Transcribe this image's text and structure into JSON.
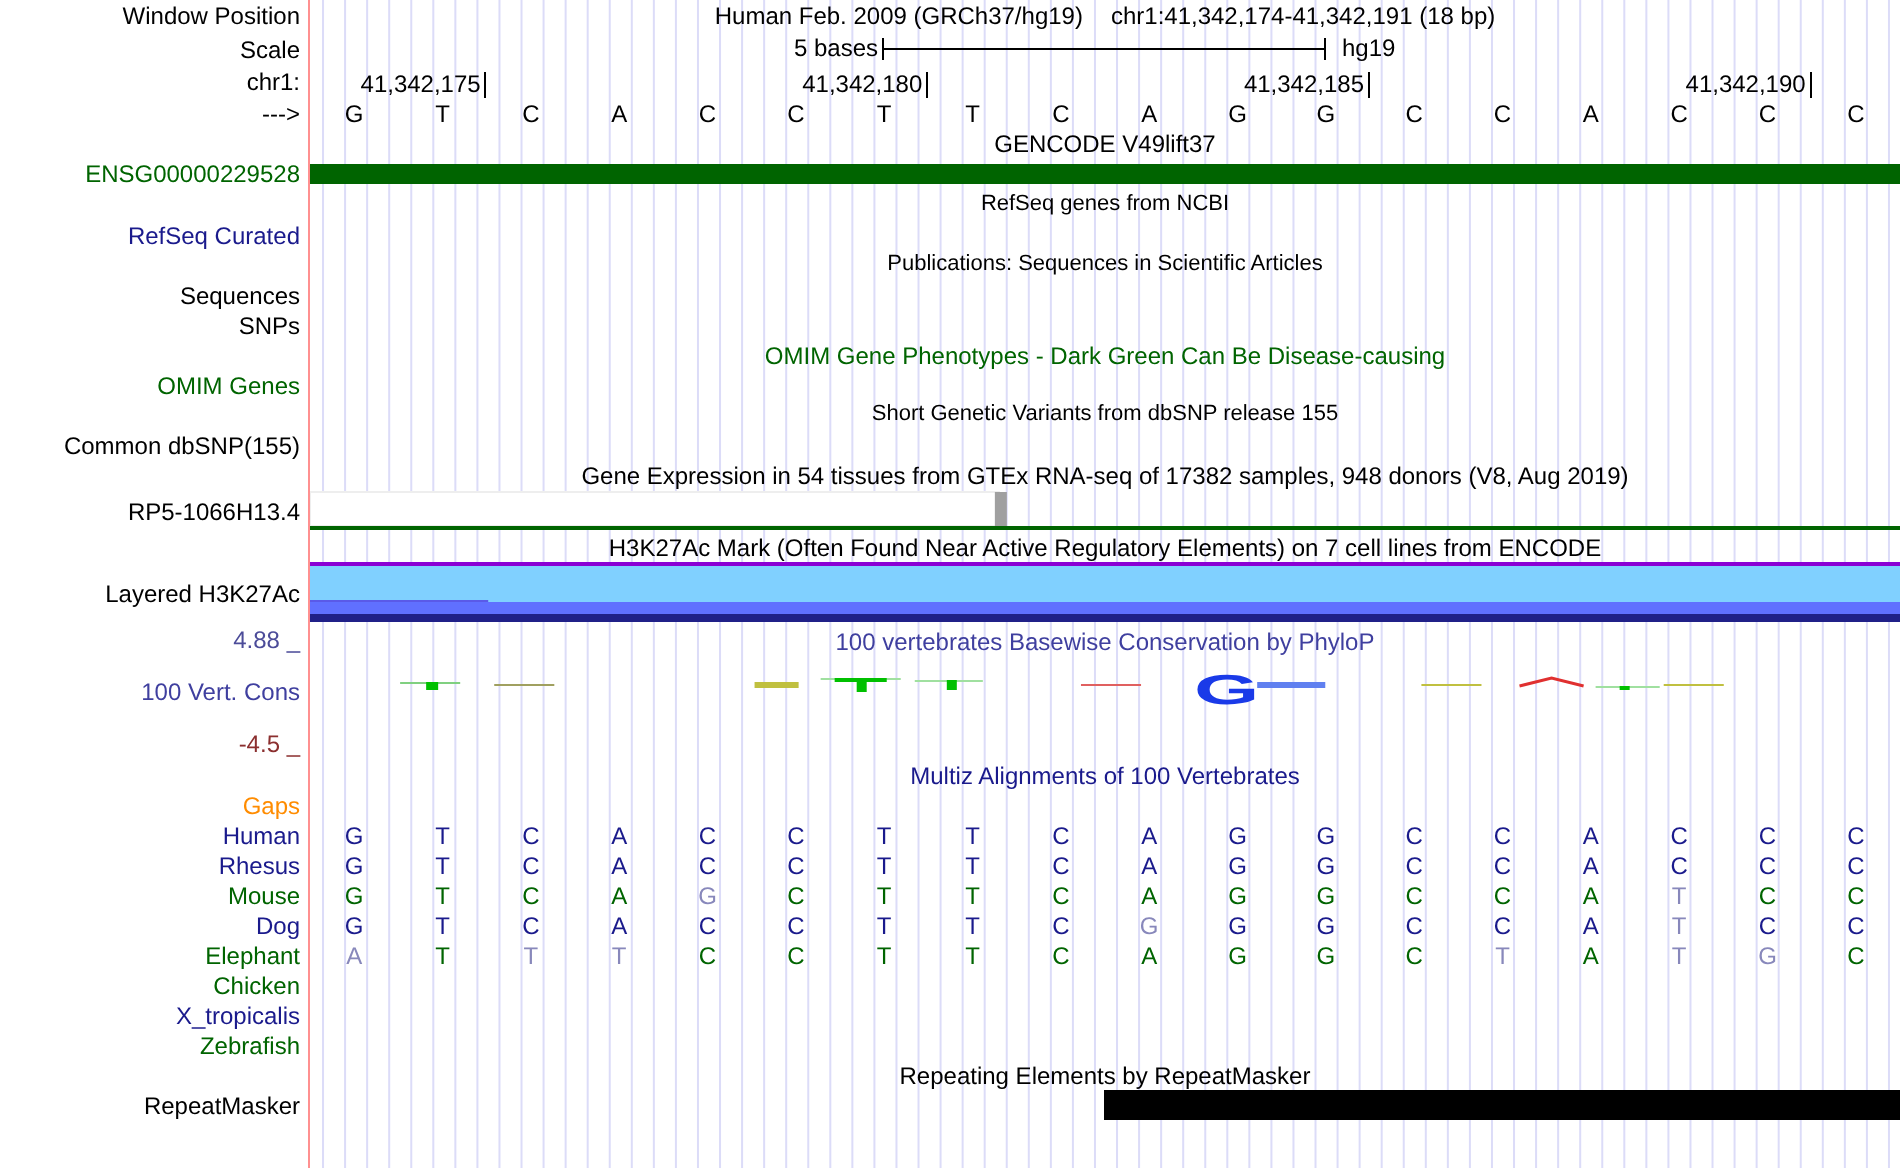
{
  "header": {
    "window_position": {
      "label": "Window Position",
      "assembly": "Human Feb. 2009 (GRCh37/hg19)",
      "position": "chr1:41,342,174-41,342,191 (18 bp)"
    },
    "scale": {
      "label": "Scale",
      "size": "5 bases",
      "assembly": "hg19"
    },
    "ruler": {
      "label": "chr1:",
      "ticks": [
        "41,342,175",
        "41,342,180",
        "41,342,185",
        "41,342,190"
      ]
    },
    "strand": {
      "label": "--->",
      "bases": [
        "G",
        "T",
        "C",
        "A",
        "C",
        "C",
        "T",
        "T",
        "C",
        "A",
        "G",
        "G",
        "C",
        "C",
        "A",
        "C",
        "C",
        "C"
      ]
    }
  },
  "tracks": [
    {
      "kind": "gene",
      "title": "GENCODE V49lift37",
      "color": "#000000",
      "small_title": false,
      "rows": [
        {
          "label": "ENSG00000229528",
          "color": "#006400"
        }
      ]
    },
    {
      "kind": "plain",
      "title": "RefSeq genes from NCBI",
      "color": "#000000",
      "small_title": true,
      "rows": [
        {
          "label": "RefSeq Curated",
          "color": "#1a1a8c"
        }
      ]
    },
    {
      "kind": "plain",
      "title": "Publications: Sequences in Scientific Articles",
      "color": "#000000",
      "small_title": true,
      "rows": [
        {
          "label": "Sequences",
          "color": "#000000"
        },
        {
          "label": "SNPs",
          "color": "#000000"
        }
      ]
    },
    {
      "kind": "plain",
      "title": "OMIM Gene Phenotypes - Dark Green Can Be Disease-causing",
      "color": "#006400",
      "small_title": false,
      "rows": [
        {
          "label": "OMIM Genes",
          "color": "#006400"
        }
      ]
    },
    {
      "kind": "plain",
      "title": "Short Genetic Variants from dbSNP release 155",
      "color": "#000000",
      "small_title": true,
      "rows": [
        {
          "label": "Common dbSNP(155)",
          "color": "#000000"
        }
      ]
    },
    {
      "kind": "expression",
      "title": "Gene Expression in 54 tissues from GTEx RNA-seq of 17382 samples, 948 donors (V8, Aug 2019)",
      "color": "#000000",
      "small_title": false,
      "rows": [
        {
          "label": "RP5-1066H13.4",
          "color": "#000000"
        }
      ]
    },
    {
      "kind": "signal",
      "title": "H3K27Ac Mark (Often Found Near Active Regulatory Elements) on 7 cell lines from ENCODE",
      "color": "#000000",
      "small_title": false,
      "rows": [
        {
          "label": "Layered H3K27Ac",
          "color": "#000000"
        }
      ]
    },
    {
      "kind": "conservation",
      "title": "100 vertebrates Basewise Conservation by PhyloP",
      "color": "#3f3f9f",
      "small_title": false,
      "max": "4.88 _",
      "min": "-4.5 _",
      "peak_letter": "G",
      "rows": [
        {
          "label": "100 Vert. Cons",
          "color": "#3f3f9f"
        }
      ]
    },
    {
      "kind": "alignment",
      "title": "Multiz Alignments of 100 Vertebrates",
      "color": "#1a1a8c",
      "small_title": false,
      "rows": [
        {
          "label": "Gaps",
          "color": "#ff8c00"
        },
        {
          "label": "Human",
          "color": "#1a1a8c",
          "bases": [
            {
              "b": "G",
              "match": true
            },
            {
              "b": "T",
              "match": true
            },
            {
              "b": "C",
              "match": true
            },
            {
              "b": "A",
              "match": true
            },
            {
              "b": "C",
              "match": true
            },
            {
              "b": "C",
              "match": true
            },
            {
              "b": "T",
              "match": true
            },
            {
              "b": "T",
              "match": true
            },
            {
              "b": "C",
              "match": true
            },
            {
              "b": "A",
              "match": true
            },
            {
              "b": "G",
              "match": true
            },
            {
              "b": "G",
              "match": true
            },
            {
              "b": "C",
              "match": true
            },
            {
              "b": "C",
              "match": true
            },
            {
              "b": "A",
              "match": true
            },
            {
              "b": "C",
              "match": true
            },
            {
              "b": "C",
              "match": true
            },
            {
              "b": "C",
              "match": true
            }
          ]
        },
        {
          "label": "Rhesus",
          "color": "#1a1a8c",
          "bases": [
            {
              "b": "G",
              "match": true
            },
            {
              "b": "T",
              "match": true
            },
            {
              "b": "C",
              "match": true
            },
            {
              "b": "A",
              "match": true
            },
            {
              "b": "C",
              "match": true
            },
            {
              "b": "C",
              "match": true
            },
            {
              "b": "T",
              "match": true
            },
            {
              "b": "T",
              "match": true
            },
            {
              "b": "C",
              "match": true
            },
            {
              "b": "A",
              "match": true
            },
            {
              "b": "G",
              "match": true
            },
            {
              "b": "G",
              "match": true
            },
            {
              "b": "C",
              "match": true
            },
            {
              "b": "C",
              "match": true
            },
            {
              "b": "A",
              "match": true
            },
            {
              "b": "C",
              "match": true
            },
            {
              "b": "C",
              "match": true
            },
            {
              "b": "C",
              "match": true
            }
          ]
        },
        {
          "label": "Mouse",
          "color": "#006400",
          "bases": [
            {
              "b": "G",
              "match": true
            },
            {
              "b": "T",
              "match": true
            },
            {
              "b": "C",
              "match": true
            },
            {
              "b": "A",
              "match": true
            },
            {
              "b": "G",
              "match": false
            },
            {
              "b": "C",
              "match": true
            },
            {
              "b": "T",
              "match": true
            },
            {
              "b": "T",
              "match": true
            },
            {
              "b": "C",
              "match": true
            },
            {
              "b": "A",
              "match": true
            },
            {
              "b": "G",
              "match": true
            },
            {
              "b": "G",
              "match": true
            },
            {
              "b": "C",
              "match": true
            },
            {
              "b": "C",
              "match": true
            },
            {
              "b": "A",
              "match": true
            },
            {
              "b": "T",
              "match": false
            },
            {
              "b": "C",
              "match": true
            },
            {
              "b": "C",
              "match": true
            }
          ]
        },
        {
          "label": "Dog",
          "color": "#1a1a8c",
          "bases": [
            {
              "b": "G",
              "match": true
            },
            {
              "b": "T",
              "match": true
            },
            {
              "b": "C",
              "match": true
            },
            {
              "b": "A",
              "match": true
            },
            {
              "b": "C",
              "match": true
            },
            {
              "b": "C",
              "match": true
            },
            {
              "b": "T",
              "match": true
            },
            {
              "b": "T",
              "match": true
            },
            {
              "b": "C",
              "match": true
            },
            {
              "b": "G",
              "match": false
            },
            {
              "b": "G",
              "match": true
            },
            {
              "b": "G",
              "match": true
            },
            {
              "b": "C",
              "match": true
            },
            {
              "b": "C",
              "match": true
            },
            {
              "b": "A",
              "match": true
            },
            {
              "b": "T",
              "match": false
            },
            {
              "b": "C",
              "match": true
            },
            {
              "b": "C",
              "match": true
            }
          ]
        },
        {
          "label": "Elephant",
          "color": "#006400",
          "bases": [
            {
              "b": "A",
              "match": false
            },
            {
              "b": "T",
              "match": true
            },
            {
              "b": "T",
              "match": false
            },
            {
              "b": "T",
              "match": false
            },
            {
              "b": "C",
              "match": true
            },
            {
              "b": "C",
              "match": true
            },
            {
              "b": "T",
              "match": true
            },
            {
              "b": "T",
              "match": true
            },
            {
              "b": "C",
              "match": true
            },
            {
              "b": "A",
              "match": true
            },
            {
              "b": "G",
              "match": true
            },
            {
              "b": "G",
              "match": true
            },
            {
              "b": "C",
              "match": true
            },
            {
              "b": "T",
              "match": false
            },
            {
              "b": "A",
              "match": true
            },
            {
              "b": "T",
              "match": false
            },
            {
              "b": "G",
              "match": false
            },
            {
              "b": "C",
              "match": true
            }
          ]
        },
        {
          "label": "Chicken",
          "color": "#006400"
        },
        {
          "label": "X_tropicalis",
          "color": "#1a1a8c"
        },
        {
          "label": "Zebrafish",
          "color": "#006400"
        }
      ]
    },
    {
      "kind": "repeat",
      "title": "Repeating Elements by RepeatMasker",
      "color": "#000000",
      "small_title": false,
      "rows": [
        {
          "label": "RepeatMasker",
          "color": "#000000"
        }
      ]
    }
  ]
}
